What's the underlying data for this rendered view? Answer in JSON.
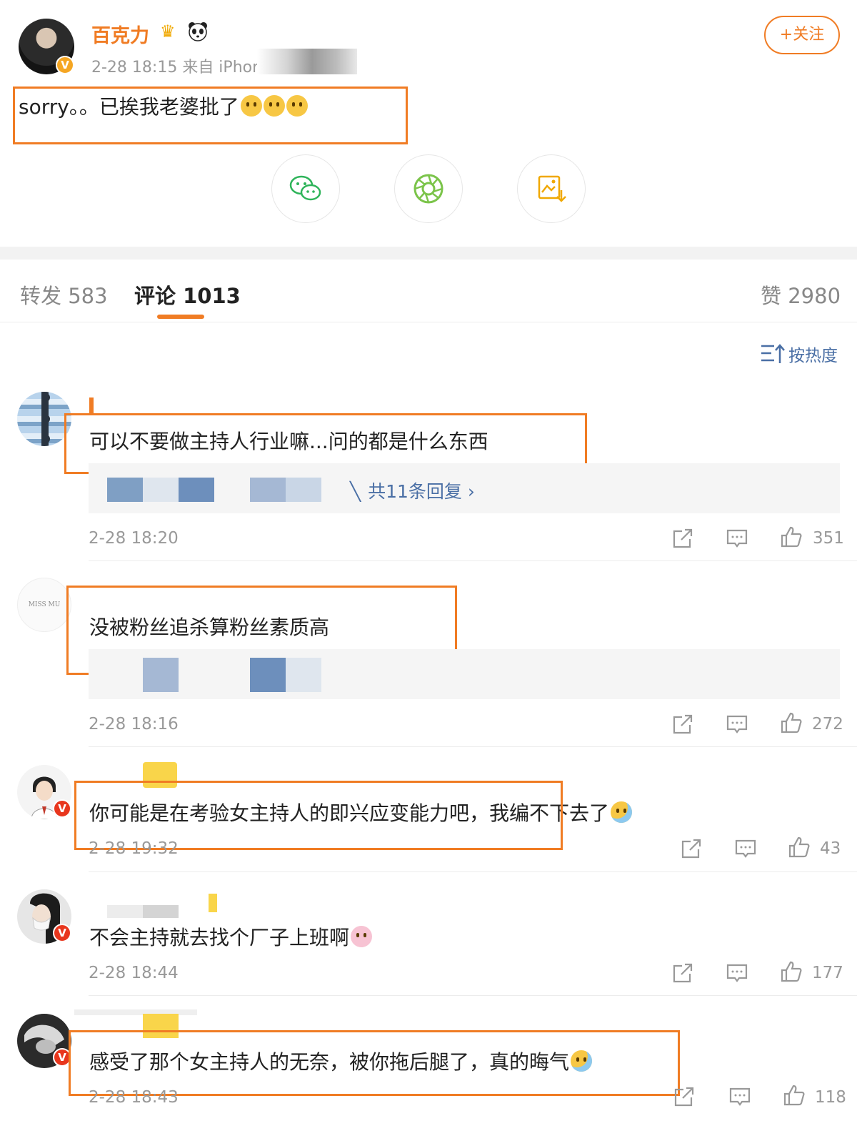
{
  "post": {
    "username": "百克力",
    "meta": "2-28 18:15  来自 iPhone",
    "follow_label": "+关注",
    "text": "sorry。。已挨我老婆批了",
    "emoji": [
      "sad-face",
      "sad-face",
      "sad-face"
    ],
    "share_buttons": [
      "wechat-icon",
      "moments-icon",
      "save-image-icon"
    ]
  },
  "tabs": {
    "repost": "转发 583",
    "comment": "评论 1013",
    "like": "赞 2980"
  },
  "sort_label": "按热度",
  "comments": [
    {
      "text": "可以不要做主持人行业嘛...问的都是什么东西",
      "reply_link": "共11条回复 ›",
      "time": "2-28 18:20",
      "likes": "351"
    },
    {
      "avatar_text": "MISS MU",
      "text": "没被粉丝追杀算粉丝素质高",
      "time": "2-28 18:16",
      "likes": "272"
    },
    {
      "text": "你可能是在考验女主持人的即兴应变能力吧，我编不下去了",
      "time": "2-28 19:32",
      "likes": "43"
    },
    {
      "text": "不会主持就去找个厂子上班啊",
      "time": "2-28 18:44",
      "likes": "177"
    },
    {
      "text": "感受了那个女主持人的无奈，被你拖后腿了，真的晦气",
      "time": "2-28 18:43",
      "likes": "118"
    }
  ],
  "colors": {
    "accent": "#f07c24",
    "link": "#4a6fa5",
    "muted": "#999999"
  }
}
